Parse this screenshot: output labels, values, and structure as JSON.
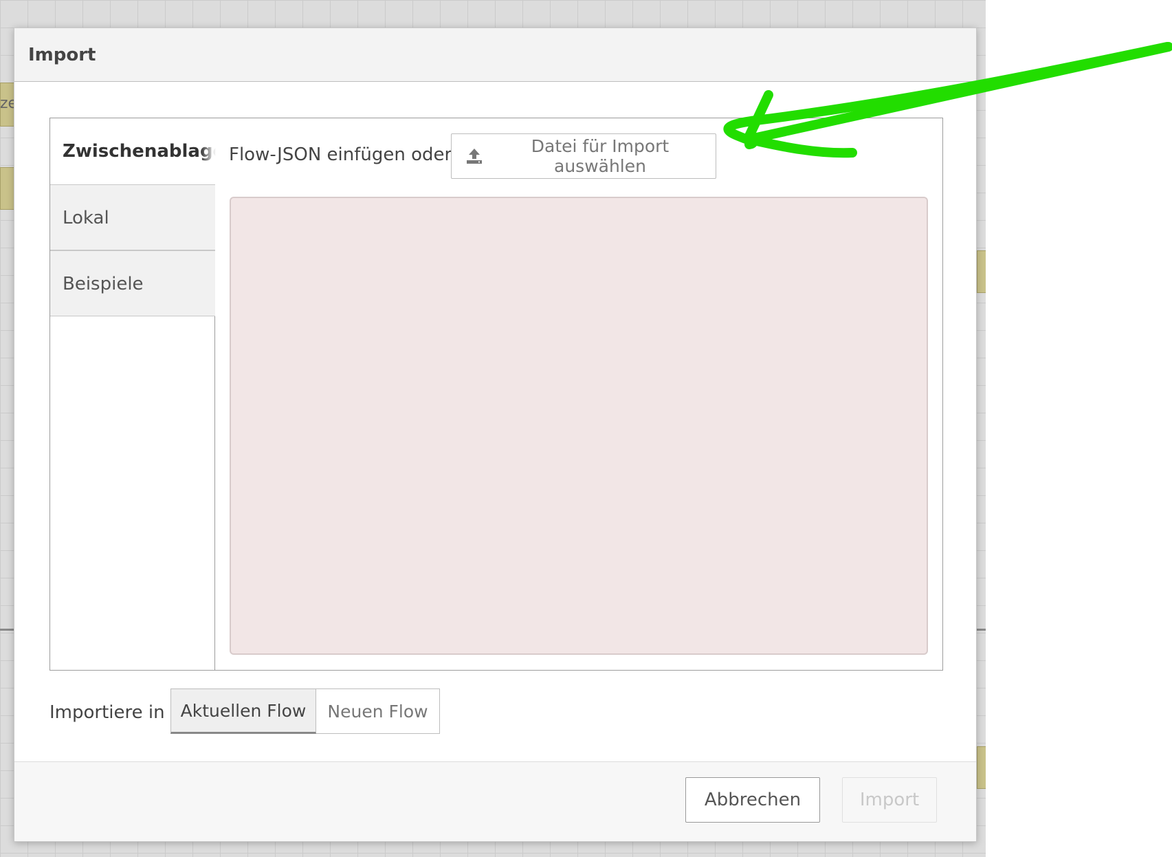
{
  "dialog": {
    "title": "Import"
  },
  "tabs": [
    {
      "label": "Zwischenablage",
      "active": true
    },
    {
      "label": "Lokal",
      "active": false
    },
    {
      "label": "Beispiele",
      "active": false
    }
  ],
  "clipboard": {
    "paste_label": "Flow-JSON einfügen oder",
    "file_button_label": "Datei für Import auswählen",
    "file_button_icon": "upload-icon",
    "textarea_value": ""
  },
  "import_target": {
    "label": "Importiere in",
    "options": [
      {
        "label": "Aktuellen Flow",
        "selected": true
      },
      {
        "label": "Neuen Flow",
        "selected": false
      }
    ]
  },
  "footer": {
    "cancel_label": "Abbrechen",
    "import_label": "Import"
  },
  "background": {
    "node_label_fragment": "ze"
  },
  "colors": {
    "annotation_arrow": "#22dd00",
    "textarea_bg": "#f2e6e6"
  }
}
